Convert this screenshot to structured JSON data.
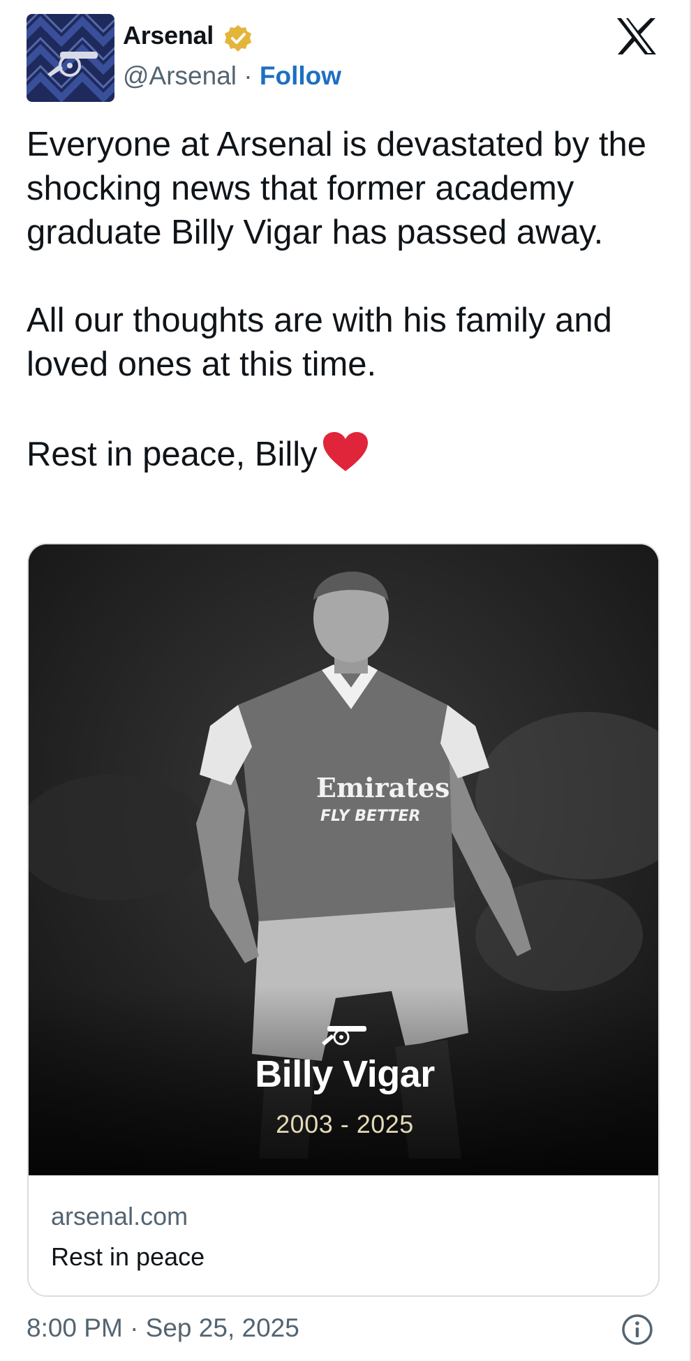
{
  "author": {
    "name": "Arsenal",
    "handle": "@Arsenal",
    "separator": " · ",
    "follow_label": "Follow",
    "verified_color": "#e3b53a"
  },
  "icons": {
    "avatar": "arsenal-cannon-crest",
    "badge": "verified-badge-icon",
    "platform": "x-logo-icon",
    "heart": "red-heart-emoji",
    "info": "info-icon"
  },
  "tweet": {
    "paragraph1": "Everyone at Arsenal is devastated by the shocking news that former academy graduate Billy Vigar has passed away.",
    "paragraph2": "All our thoughts are with his family and loved ones at this time.",
    "paragraph3": "Rest in peace, Billy"
  },
  "media": {
    "overlay_name": "Billy Vigar",
    "overlay_years": "2003 - 2025",
    "shirt_sponsor": "Emirates",
    "shirt_slogan": "FLY BETTER"
  },
  "link_card": {
    "domain": "arsenal.com",
    "title": "Rest in peace"
  },
  "footer": {
    "timestamp": "8:00 PM · Sep 25, 2025"
  },
  "colors": {
    "follow": "#1d6fc2",
    "muted_text": "#536471",
    "heart": "#e0243a",
    "years_text": "#e5d9b6"
  }
}
